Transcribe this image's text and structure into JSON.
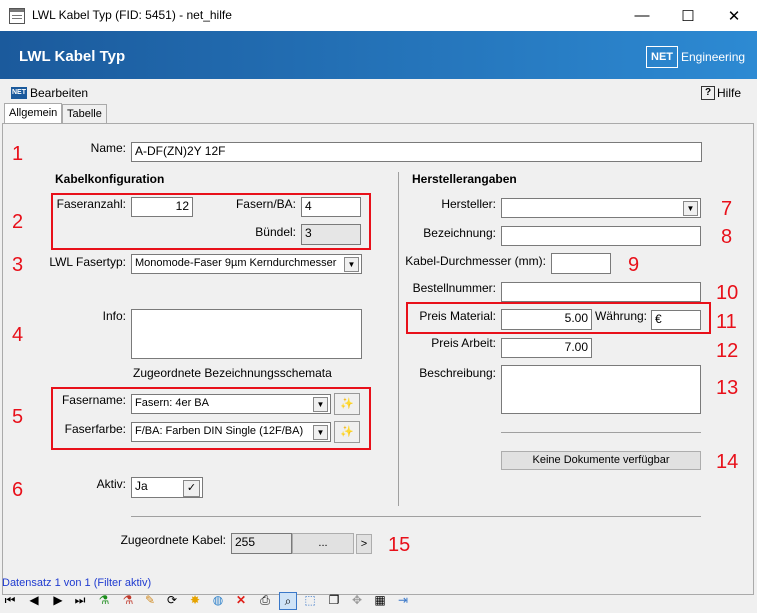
{
  "window": {
    "title": "LWL Kabel Typ (FID: 5451) - net_hilfe"
  },
  "header": {
    "title": "LWL Kabel Typ",
    "logo": "NET",
    "logo_text": "Engineering"
  },
  "menu": {
    "edit": "Bearbeiten",
    "help": "Hilfe"
  },
  "tabs": [
    "Allgemein",
    "Tabelle"
  ],
  "form": {
    "name_label": "Name:",
    "name_value": "A-DF(ZN)2Y 12F",
    "kabelkonfig_heading": "Kabelkonfiguration",
    "faseranzahl_label": "Faseranzahl:",
    "faseranzahl_value": "12",
    "fasern_ba_label": "Fasern/BA:",
    "fasern_ba_value": "4",
    "buendel_label": "Bündel:",
    "buendel_value": "3",
    "fasertyp_label": "LWL Fasertyp:",
    "fasertyp_value": "Monomode-Faser 9µm Kerndurchmesser",
    "info_label": "Info:",
    "info_value": "",
    "schemata_label": "Zugeordnete Bezeichnungsschemata",
    "fasername_label": "Fasername:",
    "fasername_value": "Fasern: 4er BA",
    "faserfarbe_label": "Faserfarbe:",
    "faserfarbe_value": "F/BA: Farben DIN Single (12F/BA)",
    "aktiv_label": "Aktiv:",
    "aktiv_value": "Ja",
    "hersteller_heading": "Herstellerangaben",
    "hersteller_label": "Hersteller:",
    "hersteller_value": "",
    "bezeichnung_label": "Bezeichnung:",
    "bezeichnung_value": "",
    "durchmesser_label": "Kabel-Durchmesser (mm):",
    "durchmesser_value": "",
    "bestellnummer_label": "Bestellnummer:",
    "bestellnummer_value": "",
    "preis_material_label": "Preis Material:",
    "preis_material_value": "5.00",
    "waehrung_label": "Währung:",
    "waehrung_value": "€",
    "preis_arbeit_label": "Preis Arbeit:",
    "preis_arbeit_value": "7.00",
    "beschreibung_label": "Beschreibung:",
    "beschreibung_value": "",
    "dokumente_button": "Keine Dokumente verfügbar",
    "kabel_label": "Zugeordnete Kabel:",
    "kabel_value": "255",
    "kabel_browse": "...",
    "kabel_next": ">"
  },
  "annotations": [
    "1",
    "2",
    "3",
    "4",
    "5",
    "6",
    "7",
    "8",
    "9",
    "10",
    "11",
    "12",
    "13",
    "14",
    "15"
  ],
  "status": {
    "record_text": "Datensatz 1 von 1 (Filter aktiv)"
  },
  "colors": {
    "header_start": "#1b5a9c",
    "header_end": "#2d8ad3",
    "annotation_red": "#e8101a",
    "status_blue": "#1f3bd0"
  }
}
